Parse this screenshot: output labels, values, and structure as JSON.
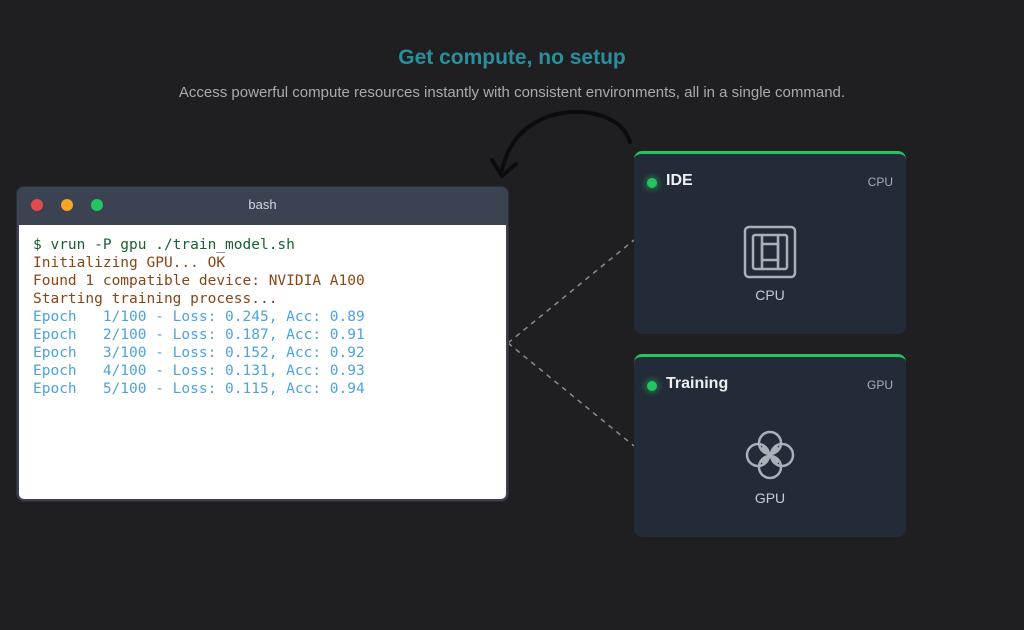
{
  "hero": {
    "title": "Get compute, no setup",
    "subtitle": "Access powerful compute resources instantly with consistent environments, all in a single command."
  },
  "terminal": {
    "title": "bash",
    "lines": [
      {
        "kind": "cmd",
        "text": "$ vrun -P gpu ./train_model.sh"
      },
      {
        "kind": "status",
        "text": "Initializing GPU... OK"
      },
      {
        "kind": "status",
        "text": "Found 1 compatible device: NVIDIA A100"
      },
      {
        "kind": "status",
        "text": "Starting training process..."
      },
      {
        "kind": "epoch",
        "text": "Epoch   1/100 - Loss: 0.245, Acc: 0.89"
      },
      {
        "kind": "epoch",
        "text": "Epoch   2/100 - Loss: 0.187, Acc: 0.91"
      },
      {
        "kind": "epoch",
        "text": "Epoch   3/100 - Loss: 0.152, Acc: 0.92"
      },
      {
        "kind": "epoch",
        "text": "Epoch   4/100 - Loss: 0.131, Acc: 0.93"
      },
      {
        "kind": "epoch",
        "text": "Epoch   5/100 - Loss: 0.115, Acc: 0.94"
      }
    ]
  },
  "cards": [
    {
      "title": "IDE",
      "tag": "CPU",
      "label": "CPU",
      "icon": "cpu-icon"
    },
    {
      "title": "Training",
      "tag": "GPU",
      "label": "GPU",
      "icon": "gpu-icon"
    }
  ],
  "colors": {
    "accent": "#2a8f9c",
    "status_active": "#22c55e",
    "card_bg": "#232a38",
    "page_bg": "#1f1f22"
  }
}
